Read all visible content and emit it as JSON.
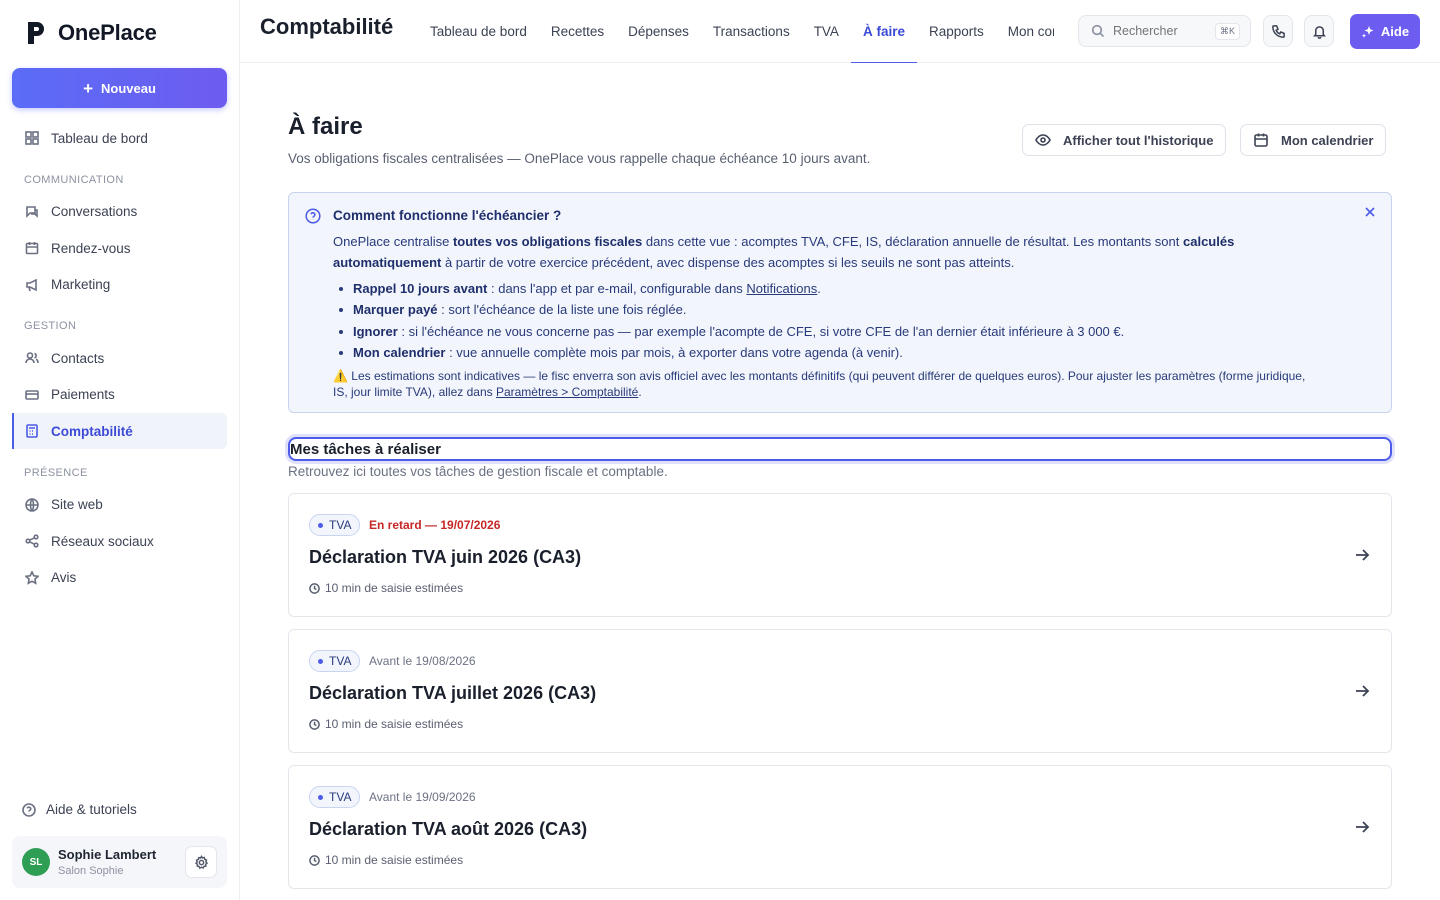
{
  "app": {
    "name": "OnePlace",
    "new_button": "Nouveau"
  },
  "sidebar": {
    "dashboard": "Tableau de bord",
    "sections": [
      {
        "title": "COMMUNICATION",
        "items": [
          "Conversations",
          "Rendez-vous",
          "Marketing"
        ]
      },
      {
        "title": "GESTION",
        "items": [
          "Contacts",
          "Paiements",
          "Comptabilité"
        ]
      },
      {
        "title": "PRÉSENCE",
        "items": [
          "Site web",
          "Réseaux sociaux",
          "Avis"
        ]
      }
    ],
    "help": "Aide & tutoriels",
    "user": {
      "initials": "SL",
      "name": "Sophie Lambert",
      "company": "Salon Sophie"
    }
  },
  "topbar": {
    "heading": "Comptabilité",
    "tabs": [
      "Tableau de bord",
      "Recettes",
      "Dépenses",
      "Transactions",
      "TVA",
      "À faire",
      "Rapports",
      "Mon compte"
    ],
    "active_tab": "À faire",
    "search_placeholder": "Rechercher",
    "search_shortcut": "⌘K",
    "help_button": "Aide"
  },
  "page": {
    "title": "À faire",
    "subtitle": "Vos obligations fiscales centralisées — OnePlace vous rappelle chaque échéance 10 jours avant.",
    "history_button": "Afficher tout l'historique",
    "calendar_button": "Mon calendrier"
  },
  "info": {
    "title": "Comment fonctionne l'échéancier ?",
    "body_1": "OnePlace centralise ",
    "body_b1": "toutes vos obligations fiscales",
    "body_2": " dans cette vue : acomptes TVA, CFE, IS, déclaration annuelle de résultat. Les montants sont ",
    "body_b2": "calculés automatiquement",
    "body_3": " à partir de votre exercice précédent, avec dispense des acomptes si les seuils ne sont pas atteints.",
    "list": [
      {
        "bold": "Rappel 10 jours avant",
        "text": " : dans l'app et par e-mail, configurable dans ",
        "link": "Notifications",
        "end": "."
      },
      {
        "bold": "Marquer payé",
        "text": " : sort l'échéance de la liste une fois réglée.",
        "link": "",
        "end": ""
      },
      {
        "bold": "Ignorer",
        "text": " : si l'échéance ne vous concerne pas — par exemple l'acompte de CFE, si votre CFE de l'an dernier était inférieure à 3 000 €.",
        "link": "",
        "end": ""
      },
      {
        "bold": "Mon calendrier",
        "text": " : vue annuelle complète mois par mois, à exporter dans votre agenda (à venir).",
        "link": "",
        "end": ""
      }
    ],
    "note": "⚠️ Les estimations sont indicatives — le fisc enverra son avis officiel avec les montants définitifs (qui peuvent différer de quelques euros). Pour ajuster les paramètres (forme juridique, IS, jour limite TVA), allez dans ",
    "note_link": "Paramètres > Comptabilité",
    "note_end": "."
  },
  "tasks_section": {
    "title": "Mes tâches à réaliser",
    "subtitle": "Retrouvez ici toutes vos tâches de gestion fiscale et comptable."
  },
  "tasks": [
    {
      "badge": "TVA",
      "due": "En retard — 19/07/2026",
      "late": true,
      "title": "Déclaration TVA juin 2026 (CA3)",
      "meta": "10 min de saisie estimées"
    },
    {
      "badge": "TVA",
      "due": "Avant le 19/08/2026",
      "late": false,
      "title": "Déclaration TVA juillet 2026 (CA3)",
      "meta": "10 min de saisie estimées"
    },
    {
      "badge": "TVA",
      "due": "Avant le 19/09/2026",
      "late": false,
      "title": "Déclaration TVA août 2026 (CA3)",
      "meta": "10 min de saisie estimées"
    }
  ],
  "colors": {
    "accent": "#4c5be8",
    "late": "#c62828",
    "info_bg": "#f2f5fc",
    "avatar": "#2e9e55"
  }
}
